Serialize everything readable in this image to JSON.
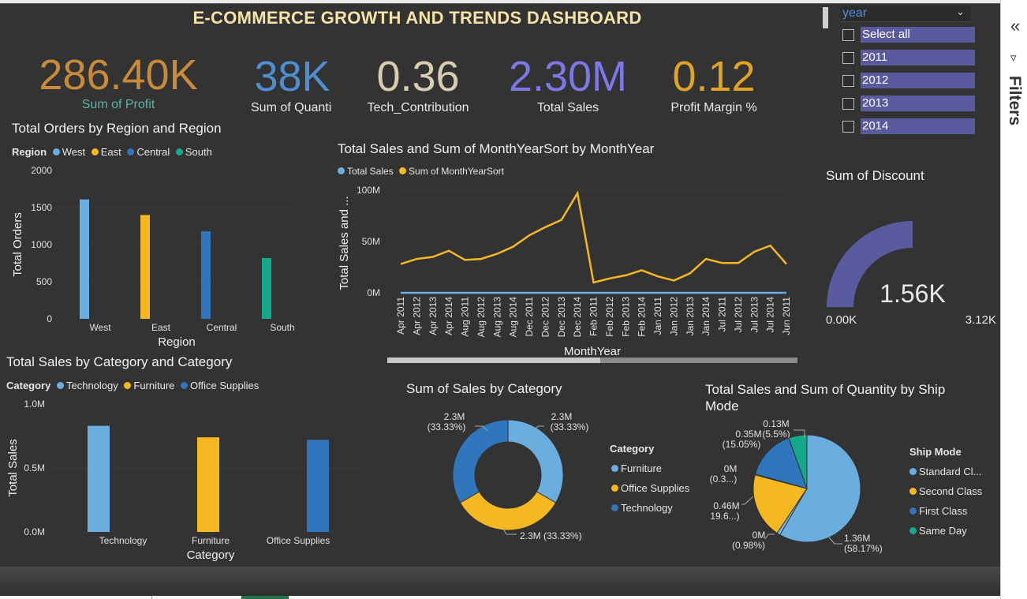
{
  "title": "E-COMMERCE GROWTH AND TRENDS DASHBOARD",
  "kpis": [
    {
      "value": "286.40K",
      "label": "Sum of Profit",
      "color": "#c98a3a",
      "label_color": "#5bb3a0"
    },
    {
      "value": "38K",
      "label": "Sum of Quanti",
      "color": "#4f8fd1",
      "label_color": "#e8e8e8"
    },
    {
      "value": "0.36",
      "label": "Tech_Contribution",
      "color": "#d9cdb0",
      "label_color": "#e8e8e8"
    },
    {
      "value": "2.30M",
      "label": "Total Sales",
      "color": "#7c79e6",
      "label_color": "#e8e8e8"
    },
    {
      "value": "0.12",
      "label": "Profit Margin %",
      "color": "#e2a321",
      "label_color": "#e8e8e8"
    }
  ],
  "slicer": {
    "field": "year",
    "items": [
      "Select all",
      "2011",
      "2012",
      "2013",
      "2014"
    ]
  },
  "filters_pane": {
    "label": "Filters",
    "collapse_icon": "double-chevron-left-icon",
    "filter_icon": "funnel-icon"
  },
  "colors": {
    "light_blue": "#6aaee0",
    "yellow": "#f5b820",
    "blue": "#2f76bd",
    "teal": "#14a88a",
    "gauge": "#5a5a9e"
  },
  "region_chart": {
    "title": "Total Orders by Region and Region",
    "legend_title": "Region",
    "legend": [
      "West",
      "East",
      "Central",
      "South"
    ],
    "chart_data": {
      "type": "bar",
      "categories": [
        "West",
        "East",
        "Central",
        "South"
      ],
      "values": [
        1610,
        1400,
        1180,
        820
      ],
      "xlabel": "Region",
      "ylabel": "Total Orders",
      "ylim": [
        0,
        2000
      ],
      "yticks": [
        "0",
        "500",
        "1000",
        "1500",
        "2000"
      ]
    }
  },
  "line_chart": {
    "title": "Total Sales and Sum of MonthYearSort by MonthYear",
    "legend": [
      "Total Sales",
      "Sum of MonthYearSort"
    ],
    "chart_data": {
      "type": "line",
      "x": [
        "Apr 2011",
        "Apr 2012",
        "Apr 2013",
        "Apr 2014",
        "Aug 2011",
        "Aug 2012",
        "Aug 2013",
        "Aug 2014",
        "Dec 2011",
        "Dec 2012",
        "Dec 2013",
        "Dec 2014",
        "Feb 2011",
        "Feb 2012",
        "Feb 2013",
        "Feb 2014",
        "Jan 2011",
        "Jan 2012",
        "Jan 2013",
        "Jan 2014",
        "Jul 2011",
        "Jul 2012",
        "Jul 2013",
        "Jul 2014",
        "Jun 2011"
      ],
      "series": [
        {
          "name": "Total Sales",
          "values": [
            0.03,
            0.03,
            0.03,
            0.03,
            0.03,
            0.03,
            0.03,
            0.03,
            0.03,
            0.03,
            0.03,
            0.03,
            0.03,
            0.03,
            0.03,
            0.03,
            0.03,
            0.03,
            0.03,
            0.03,
            0.03,
            0.03,
            0.03,
            0.03,
            0.03
          ]
        },
        {
          "name": "Sum of MonthYearSort",
          "values": [
            28,
            33,
            35,
            41,
            32,
            33,
            38,
            45,
            56,
            64,
            71,
            97,
            10,
            14,
            17,
            22,
            16,
            12,
            19,
            33,
            29,
            29,
            40,
            46,
            28
          ]
        }
      ],
      "xlabel": "MonthYear",
      "ylabel": "Total Sales and ...",
      "ylim": [
        0,
        100
      ],
      "yticks": [
        "0M",
        "50M",
        "100M"
      ]
    }
  },
  "gauge": {
    "title": "Sum of Discount",
    "value": "1.56K",
    "min": "0.00K",
    "max": "3.12K",
    "fraction": 0.5
  },
  "category_chart": {
    "title": "Total Sales by Category and Category",
    "legend_title": "Category",
    "legend": [
      "Technology",
      "Furniture",
      "Office Supplies"
    ],
    "chart_data": {
      "type": "bar",
      "categories": [
        "Technology",
        "Furniture",
        "Office Supplies"
      ],
      "values": [
        0.83,
        0.74,
        0.72
      ],
      "xlabel": "Category",
      "ylabel": "Total Sales",
      "ylim": [
        0,
        1.0
      ],
      "yticks": [
        "0.0M",
        "0.5M",
        "1.0M"
      ]
    }
  },
  "donut": {
    "title": "Sum of Sales by Category",
    "legend_title": "Category",
    "legend": [
      "Furniture",
      "Office Supplies",
      "Technology"
    ],
    "labels": [
      {
        "value": "2.3M",
        "pct": "(33.33%)"
      },
      {
        "value": "2.3M",
        "pct": "(33.33%)"
      },
      {
        "value": "2.3M (33.33%)",
        "pct": ""
      }
    ],
    "chart_data": {
      "type": "pie",
      "categories": [
        "Furniture",
        "Office Supplies",
        "Technology"
      ],
      "values": [
        33.33,
        33.33,
        33.33
      ]
    }
  },
  "pie": {
    "title": "Total Sales and Sum of Quantity by Ship Mode",
    "legend_title": "Ship Mode",
    "legend": [
      "Standard Cl...",
      "Second Class",
      "First Class",
      "Same Day"
    ],
    "labels": [
      {
        "l1": "1.36M",
        "l2": "(58.17%)"
      },
      {
        "l1": "0M",
        "l2": "(0.98%)"
      },
      {
        "l1": "0.46M",
        "l2": "(19.6...)"
      },
      {
        "l1": "0M",
        "l2": "(0.3...)"
      },
      {
        "l1": "0.35M",
        "l2": "(15.05%)"
      },
      {
        "l1": "0.13M",
        "l2": "(5.5%)"
      }
    ],
    "chart_data": {
      "type": "pie",
      "categories": [
        "Standard Class",
        "Second Class (qty)",
        "Second Class",
        "First Class (qty)",
        "First Class",
        "Same Day"
      ],
      "values": [
        58.17,
        0.98,
        19.6,
        0.3,
        15.05,
        5.5
      ]
    }
  }
}
